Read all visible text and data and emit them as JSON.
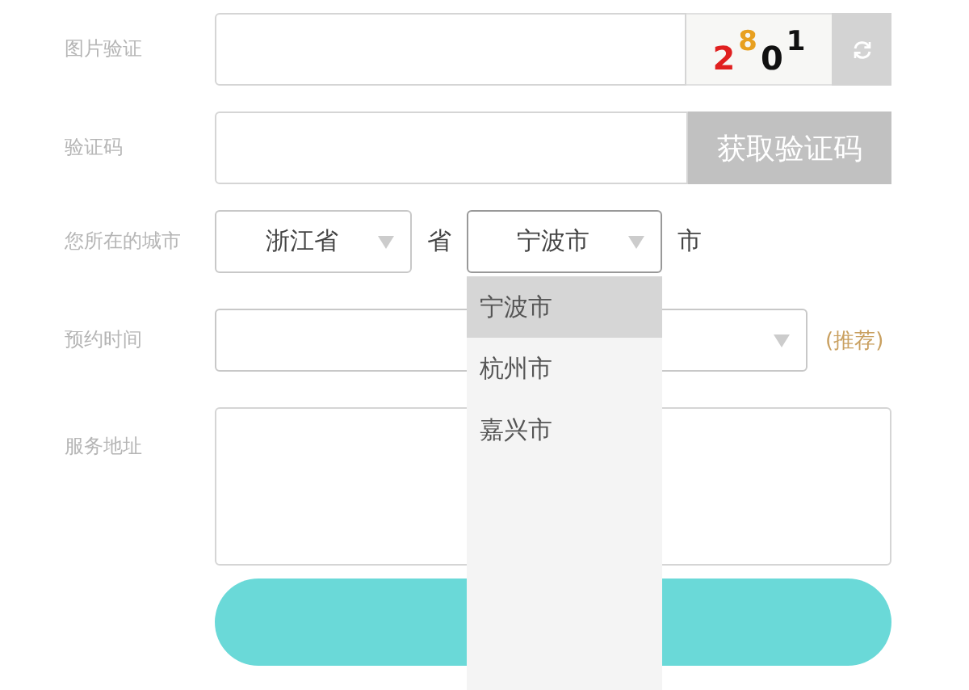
{
  "form": {
    "captcha_row": {
      "label": "图片验证",
      "captcha_digits": [
        {
          "text": "2",
          "color": "#e02020",
          "raised": false
        },
        {
          "text": "8",
          "color": "#e8a020",
          "raised": true
        },
        {
          "text": "0",
          "color": "#111111",
          "raised": false
        },
        {
          "text": "1",
          "color": "#111111",
          "raised": true
        }
      ]
    },
    "code_row": {
      "label": "验证码",
      "button": "获取验证码"
    },
    "city_row": {
      "label": "您所在的城市",
      "province": {
        "value": "浙江省",
        "expanded": false
      },
      "province_suffix": "省",
      "city": {
        "value": "宁波市",
        "expanded": true,
        "options": [
          {
            "label": "宁波市",
            "selected": true
          },
          {
            "label": "杭州市",
            "selected": false
          },
          {
            "label": "嘉兴市",
            "selected": false
          }
        ]
      },
      "city_suffix": "市"
    },
    "time_row": {
      "label": "预约时间",
      "hint": "(推荐)"
    },
    "address_row": {
      "label": "服务地址"
    }
  }
}
